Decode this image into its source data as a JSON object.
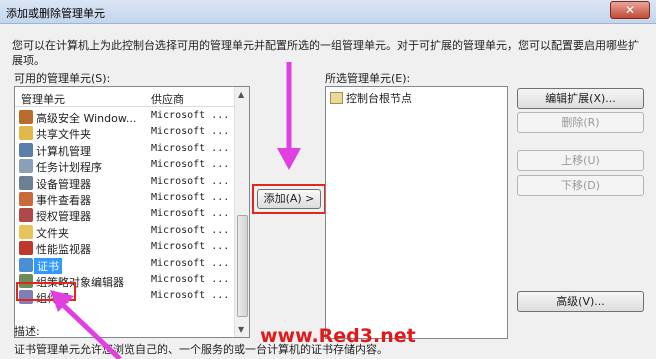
{
  "window": {
    "title": "添加或删除管理单元",
    "close_glyph": "✕"
  },
  "description": "您可以在计算机上为此控制台选择可用的管理单元并配置所选的一组管理单元。对于可扩展的管理单元，您可以配置要启用哪些扩展项。",
  "available": {
    "label": "可用的管理单元(S):",
    "col_name": "管理单元",
    "col_vendor": "供应商",
    "items": [
      {
        "name": "高级安全 Window...",
        "vendor": "Microsoft ...",
        "icon": "firewall-icon"
      },
      {
        "name": "共享文件夹",
        "vendor": "Microsoft ...",
        "icon": "shared-folder-icon"
      },
      {
        "name": "计算机管理",
        "vendor": "Microsoft ...",
        "icon": "computer-management-icon"
      },
      {
        "name": "任务计划程序",
        "vendor": "Microsoft ...",
        "icon": "clock-icon"
      },
      {
        "name": "设备管理器",
        "vendor": "Microsoft ...",
        "icon": "device-manager-icon"
      },
      {
        "name": "事件查看器",
        "vendor": "Microsoft ...",
        "icon": "event-viewer-icon"
      },
      {
        "name": "授权管理器",
        "vendor": "Microsoft ...",
        "icon": "authorization-icon"
      },
      {
        "name": "文件夹",
        "vendor": "Microsoft ...",
        "icon": "folder-icon"
      },
      {
        "name": "性能监视器",
        "vendor": "Microsoft ...",
        "icon": "performance-icon"
      },
      {
        "name": "证书",
        "vendor": "Microsoft ...",
        "icon": "certificate-icon"
      },
      {
        "name": "组策略对象编辑器",
        "vendor": "Microsoft ...",
        "icon": "group-policy-icon"
      },
      {
        "name": "组件服",
        "vendor": "Microsoft ...",
        "icon": "component-services-icon"
      }
    ]
  },
  "add_button": "添加(A) >",
  "selected": {
    "label": "所选管理单元(E):",
    "items": [
      {
        "name": "控制台根节点",
        "icon": "folder-icon"
      }
    ]
  },
  "buttons": {
    "edit_extensions": "编辑扩展(X)...",
    "remove": "删除(R)",
    "move_up": "上移(U)",
    "move_down": "下移(D)",
    "advanced": "高级(V)..."
  },
  "description_section": {
    "label": "描述:",
    "text": "证书管理单元允许您浏览自己的、一个服务的或一台计算机的证书存储内容。"
  },
  "watermark": "www.Red3.net",
  "colors": {
    "accent_arrow": "#e040e0",
    "highlight_frame": "#e0271e",
    "selection": "#3399ff"
  }
}
